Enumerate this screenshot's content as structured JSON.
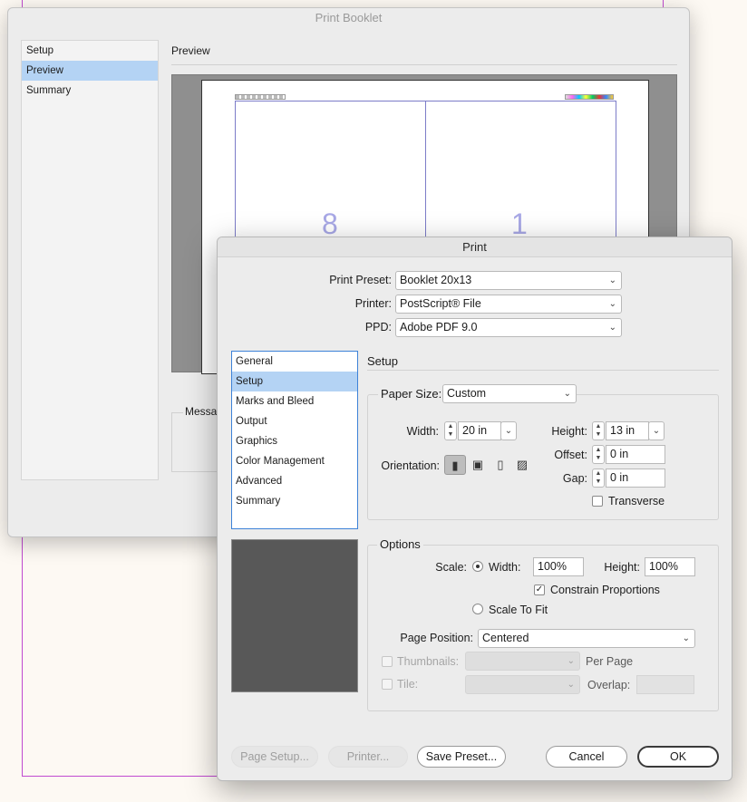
{
  "booklet": {
    "title": "Print Booklet",
    "sidebar": [
      "Setup",
      "Preview",
      "Summary"
    ],
    "selected_index": 1,
    "section_title": "Preview",
    "page_numbers": [
      "8",
      "1"
    ],
    "messages_label": "Messa"
  },
  "print": {
    "title": "Print",
    "preset_label": "Print Preset:",
    "preset_value": "Booklet 20x13",
    "printer_label": "Printer:",
    "printer_value": "PostScript® File",
    "ppd_label": "PPD:",
    "ppd_value": "Adobe PDF 9.0",
    "categories": [
      "General",
      "Setup",
      "Marks and Bleed",
      "Output",
      "Graphics",
      "Color Management",
      "Advanced",
      "Summary"
    ],
    "selected_category": 1,
    "section_title": "Setup",
    "paper_size_label": "Paper Size:",
    "paper_size_value": "Custom",
    "width_label": "Width:",
    "width_value": "20 in",
    "height_label": "Height:",
    "height_value": "13 in",
    "offset_label": "Offset:",
    "offset_value": "0 in",
    "gap_label": "Gap:",
    "gap_value": "0 in",
    "orientation_label": "Orientation:",
    "transverse_label": "Transverse",
    "options_title": "Options",
    "scale_label": "Scale:",
    "scale_width_label": "Width:",
    "scale_width_value": "100%",
    "scale_height_label": "Height:",
    "scale_height_value": "100%",
    "constrain_label": "Constrain Proportions",
    "scale_to_fit_label": "Scale To Fit",
    "page_position_label": "Page Position:",
    "page_position_value": "Centered",
    "thumbnails_label": "Thumbnails:",
    "per_page_label": "Per Page",
    "tile_label": "Tile:",
    "overlap_label": "Overlap:",
    "buttons": {
      "page_setup": "Page Setup...",
      "printer": "Printer...",
      "save_preset": "Save Preset...",
      "cancel": "Cancel",
      "ok": "OK"
    }
  }
}
